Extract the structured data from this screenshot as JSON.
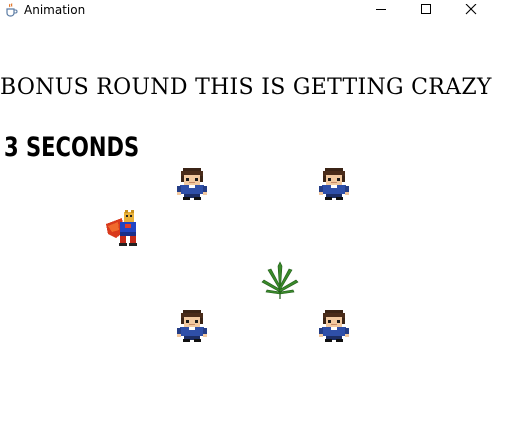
{
  "window": {
    "title": "Animation",
    "controls": [
      "minimize",
      "maximize",
      "close"
    ]
  },
  "game": {
    "banner": "BONUS ROUND THIS IS GETTING CRAZY",
    "timer": "3 SECONDS",
    "sprites": {
      "player": "caped-hero-sprite",
      "item": "leaf-plant-sprite",
      "enemies": [
        "boy-sprite",
        "boy-sprite",
        "boy-sprite",
        "boy-sprite"
      ]
    }
  }
}
